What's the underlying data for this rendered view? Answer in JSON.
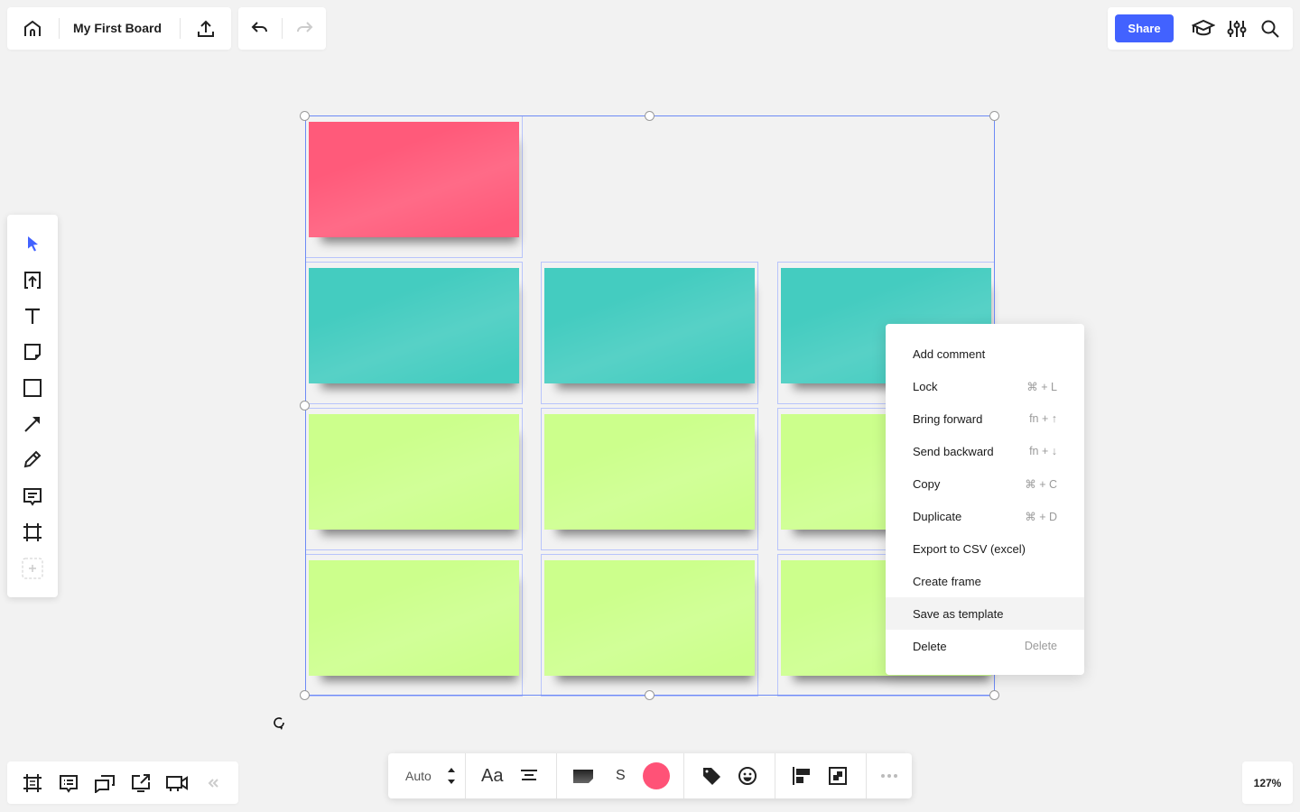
{
  "header": {
    "board_title": "My First Board",
    "home_icon": "home-icon",
    "export_icon": "upload-icon",
    "undo_icon": "undo-icon",
    "redo_icon": "redo-icon",
    "redo_enabled": false
  },
  "top_right": {
    "share_label": "Share",
    "icons": [
      "graduation-cap-icon",
      "settings-sliders-icon",
      "search-icon"
    ],
    "accent_color": "#4262ff"
  },
  "left_toolbar": {
    "tools": [
      {
        "name": "select",
        "icon": "cursor-icon",
        "active": true
      },
      {
        "name": "upload",
        "icon": "upload-frame-icon"
      },
      {
        "name": "text",
        "icon": "text-icon"
      },
      {
        "name": "sticky-note",
        "icon": "sticky-note-icon"
      },
      {
        "name": "shape",
        "icon": "rectangle-icon"
      },
      {
        "name": "connection-line",
        "icon": "arrow-icon"
      },
      {
        "name": "pen",
        "icon": "pencil-icon"
      },
      {
        "name": "comment",
        "icon": "comment-icon"
      },
      {
        "name": "frame",
        "icon": "frame-icon"
      },
      {
        "name": "more-tools",
        "icon": "add-icon"
      }
    ]
  },
  "bottom_left": {
    "icons": [
      "frames-icon",
      "comments-icon",
      "chat-icon",
      "share-screen-icon",
      "video-icon",
      "collapse-icon"
    ]
  },
  "bottom_toolbar": {
    "font_size_label": "Auto",
    "font_label": "Aa",
    "align_icon": "align-center-icon",
    "sticky_icon": "sticky-shape-icon",
    "size_label": "S",
    "color": "#ff5277",
    "tag_icon": "tag-icon",
    "emoji_icon": "emoji-icon",
    "align_objects_icon": "align-objects-icon",
    "group_icon": "group-icon",
    "more_icon": "more-icon"
  },
  "zoom": {
    "level": "127%"
  },
  "canvas": {
    "colors": {
      "pink": "#ff5a7a",
      "teal": "#44ccc0",
      "lime": "#ccff8c"
    },
    "notes": [
      {
        "row": 0,
        "col": 0,
        "color": "pink"
      },
      {
        "row": 1,
        "col": 0,
        "color": "teal"
      },
      {
        "row": 1,
        "col": 1,
        "color": "teal"
      },
      {
        "row": 1,
        "col": 2,
        "color": "teal"
      },
      {
        "row": 2,
        "col": 0,
        "color": "lime"
      },
      {
        "row": 2,
        "col": 1,
        "color": "lime"
      },
      {
        "row": 2,
        "col": 2,
        "color": "lime"
      },
      {
        "row": 3,
        "col": 0,
        "color": "lime"
      },
      {
        "row": 3,
        "col": 1,
        "color": "lime"
      },
      {
        "row": 3,
        "col": 2,
        "color": "lime"
      }
    ]
  },
  "context_menu": {
    "items": [
      {
        "label": "Add comment",
        "shortcut": ""
      },
      {
        "label": "Lock",
        "shortcut": "⌘ + L"
      },
      {
        "label": "Bring forward",
        "shortcut": "fn + ↑"
      },
      {
        "label": "Send backward",
        "shortcut": "fn + ↓"
      },
      {
        "label": "Copy",
        "shortcut": "⌘ + C"
      },
      {
        "label": "Duplicate",
        "shortcut": "⌘ + D"
      },
      {
        "label": "Export to CSV (excel)",
        "shortcut": ""
      },
      {
        "label": "Create frame",
        "shortcut": ""
      },
      {
        "label": "Save as template",
        "shortcut": "",
        "hovered": true
      },
      {
        "label": "Delete",
        "shortcut": "Delete"
      }
    ]
  }
}
